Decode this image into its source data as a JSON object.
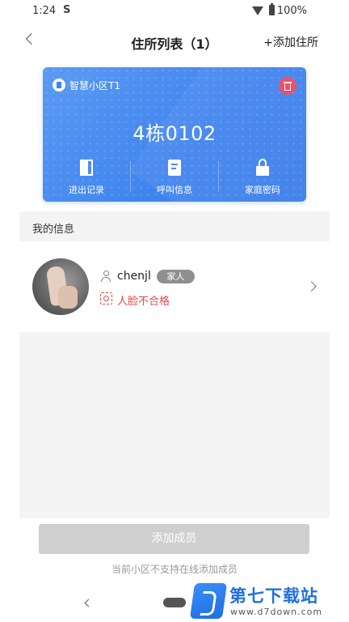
{
  "status_bar": {
    "time": "1:24",
    "sim_icon": "S",
    "battery": "100%"
  },
  "header": {
    "title": "住所列表（1）",
    "add_label": "+添加住所"
  },
  "card": {
    "community_name": "智慧小区T1",
    "unit_number": "4栋0102",
    "actions": [
      {
        "label": "进出记录",
        "icon": "door-icon"
      },
      {
        "label": "呼叫信息",
        "icon": "call-info-icon"
      },
      {
        "label": "家庭密码",
        "icon": "lock-icon"
      }
    ],
    "accent_color": "#4285F4",
    "delete_color": "#EF4F6B"
  },
  "my_info": {
    "section_title": "我的信息",
    "member": {
      "name": "chenjl",
      "role": "家人",
      "face_status": "人脸不合格"
    }
  },
  "footer": {
    "add_member_label": "添加成员",
    "notice": "当前小区不支持在线添加成员"
  },
  "watermark": {
    "title": "第七下载站",
    "url": "www.d7down.com"
  }
}
